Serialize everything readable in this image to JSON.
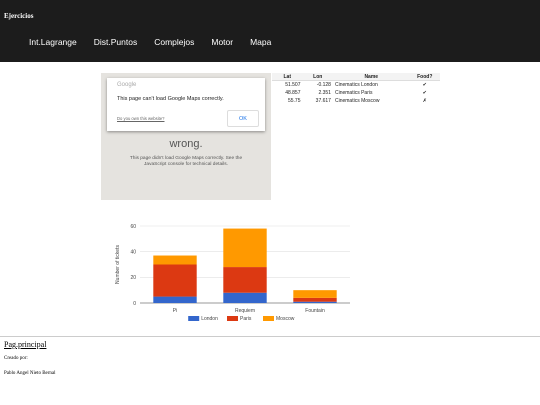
{
  "header": {
    "brand": "Ejercicios",
    "nav": [
      "Int.Lagrange",
      "Dist.Puntos",
      "Complejos",
      "Motor",
      "Mapa"
    ]
  },
  "map": {
    "dialog_logo": "Google",
    "dialog_message": "This page can't load Google Maps correctly.",
    "dialog_link": "Do you own this website?",
    "ok_label": "OK",
    "error_title": "wrong.",
    "error_text": "This page didn't load Google Maps correctly. See the JavaScript console for technical details."
  },
  "table": {
    "headers": [
      "Lat",
      "Lon",
      "Name",
      "Food?"
    ],
    "rows": [
      [
        "51.507",
        "-0.128",
        "Cinematics London",
        "✔"
      ],
      [
        "48.857",
        "2.351",
        "Cinematics Paris",
        "✔"
      ],
      [
        "55.75",
        "37.617",
        "Cinematics Moscow",
        "✗"
      ]
    ]
  },
  "chart_data": {
    "type": "bar",
    "stacked": true,
    "categories": [
      "Pi",
      "Requiem",
      "Fountain"
    ],
    "series": [
      {
        "name": "London",
        "color": "#3366cc",
        "values": [
          5,
          8,
          1
        ]
      },
      {
        "name": "Paris",
        "color": "#dc3912",
        "values": [
          25,
          20,
          3
        ]
      },
      {
        "name": "Moscow",
        "color": "#ff9900",
        "values": [
          7,
          30,
          6
        ]
      }
    ],
    "ylabel": "Number of tickets",
    "ylim": [
      0,
      60
    ],
    "yticks": [
      0,
      20,
      40,
      60
    ],
    "grid": true,
    "legend": "bottom"
  },
  "footer": {
    "link": "Pag.principal",
    "created_by": "Creado por:",
    "author": "Pablo Angel Nieto Bernal"
  }
}
